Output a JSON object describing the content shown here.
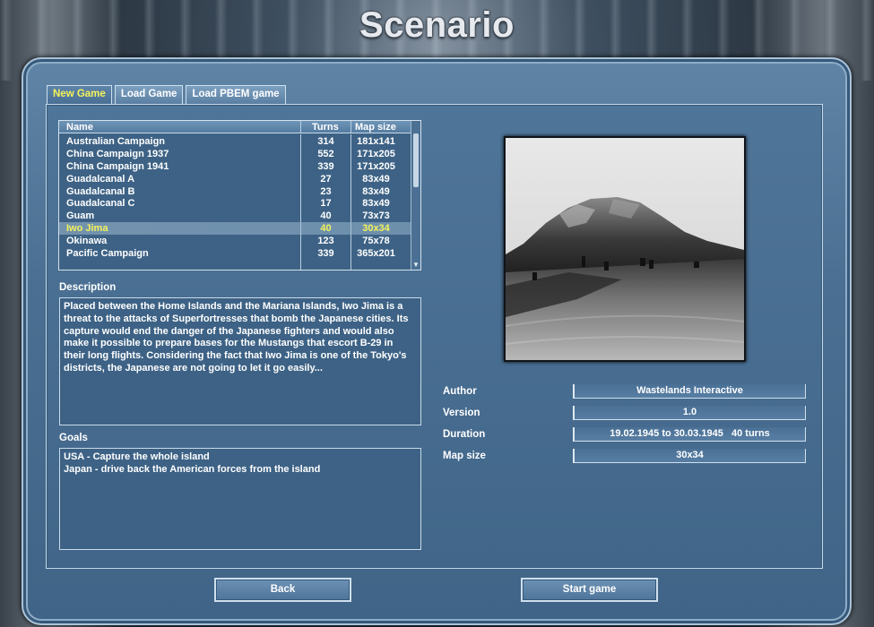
{
  "screen_title": "Scenario",
  "tabs": [
    {
      "label": "New Game",
      "active": true
    },
    {
      "label": "Load Game",
      "active": false
    },
    {
      "label": "Load PBEM game",
      "active": false
    }
  ],
  "list": {
    "headers": {
      "name": "Name",
      "turns": "Turns",
      "map_size": "Map size"
    },
    "rows": [
      {
        "name": "Australian Campaign",
        "turns": "314",
        "map_size": "181x141"
      },
      {
        "name": "China Campaign 1937",
        "turns": "552",
        "map_size": "171x205"
      },
      {
        "name": "China Campaign 1941",
        "turns": "339",
        "map_size": "171x205"
      },
      {
        "name": "Guadalcanal A",
        "turns": "27",
        "map_size": "83x49"
      },
      {
        "name": "Guadalcanal B",
        "turns": "23",
        "map_size": "83x49"
      },
      {
        "name": "Guadalcanal C",
        "turns": "17",
        "map_size": "83x49"
      },
      {
        "name": "Guam",
        "turns": "40",
        "map_size": "73x73"
      },
      {
        "name": "Iwo Jima",
        "turns": "40",
        "map_size": "30x34",
        "selected": true
      },
      {
        "name": "Okinawa",
        "turns": "123",
        "map_size": "75x78"
      },
      {
        "name": "Pacific Campaign",
        "turns": "339",
        "map_size": "365x201"
      }
    ]
  },
  "description": {
    "label": "Description",
    "text": "Placed between the Home Islands and the Mariana Islands, Iwo Jima is a threat to the attacks of Superfortresses that bomb the Japanese cities. Its capture would end the danger of the Japanese fighters and would also make it possible to prepare bases for the Mustangs that escort B-29 in their long flights. Considering the fact that Iwo Jima is one of the Tokyo's districts, the Japanese are not going to let it go easily..."
  },
  "goals": {
    "label": "Goals",
    "lines": [
      "USA - Capture the whole island",
      "Japan - drive back the American forces from the island"
    ]
  },
  "info": {
    "author_label": "Author",
    "author": "Wastelands Interactive",
    "version_label": "Version",
    "version": "1.0",
    "duration_label": "Duration",
    "duration": "19.02.1945 to 30.03.1945   40 turns",
    "map_size_label": "Map size",
    "map_size": "30x34"
  },
  "buttons": {
    "back": "Back",
    "start": "Start game"
  },
  "colors": {
    "selected_text": "#f3f35a",
    "panel": "#416689"
  }
}
